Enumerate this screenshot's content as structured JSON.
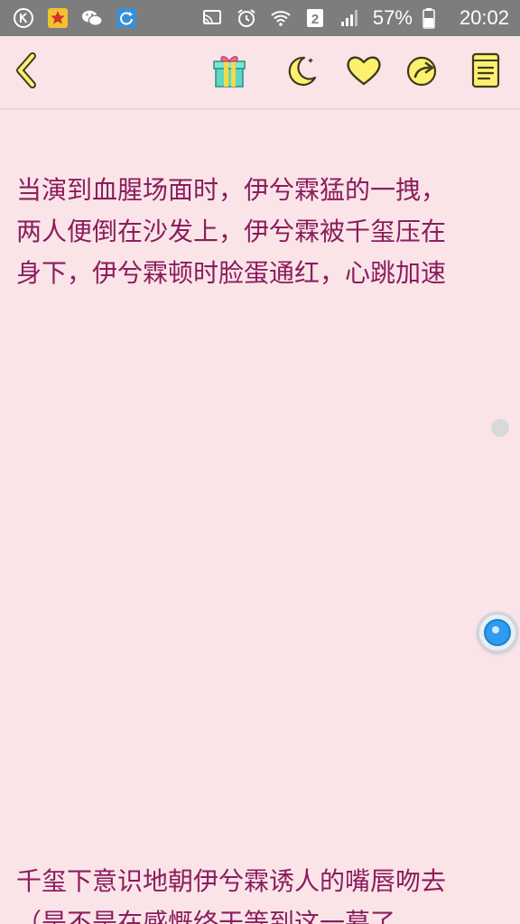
{
  "status_bar": {
    "battery_percent": "57%",
    "time": "20:02",
    "sim_slot": "2",
    "left_icons": [
      "k-icon",
      "star-app-icon",
      "wechat-icon",
      "sync-app-icon"
    ],
    "right_icons": [
      "cast-icon",
      "alarm-icon",
      "wifi-icon",
      "sim2-icon",
      "signal-icon",
      "battery-icon"
    ]
  },
  "toolbar": {
    "icons": [
      "back-icon",
      "gift-icon",
      "moon-icon",
      "heart-icon",
      "share-icon",
      "book-icon"
    ]
  },
  "content": {
    "paragraph_1": "当演到血腥场面时，伊兮霖猛的一拽，两人便倒在沙发上，伊兮霖被千玺压在身下，伊兮霖顿时脸蛋通红，心跳加速",
    "paragraph_2": "千玺下意识地朝伊兮霖诱人的嘴唇吻去（是不是在感慨终于等到这一幕了"
  },
  "colors": {
    "background": "#fae4e8",
    "text": "#8b1d5d",
    "icon_yellow": "#fdf06f",
    "icon_outline": "#3e3a1e",
    "status_bar": "#7d7d7d"
  }
}
